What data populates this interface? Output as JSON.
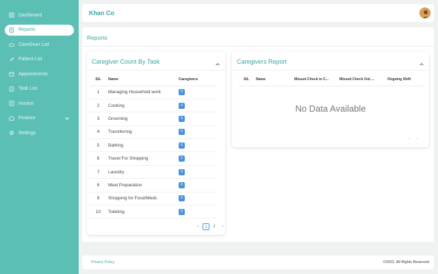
{
  "sidebar": {
    "items": [
      {
        "label": "Dashboard",
        "icon": "dashboard-icon"
      },
      {
        "label": "Reports",
        "icon": "reports-icon",
        "active": true
      },
      {
        "label": "CareGiver List",
        "icon": "caregiver-icon"
      },
      {
        "label": "Patient List",
        "icon": "patient-icon"
      },
      {
        "label": "Appointments",
        "icon": "calendar-icon"
      },
      {
        "label": "Task List",
        "icon": "task-icon"
      },
      {
        "label": "Invoice",
        "icon": "invoice-icon"
      },
      {
        "label": "Finance",
        "icon": "finance-icon"
      },
      {
        "label": "Settings",
        "icon": "gear-icon"
      }
    ]
  },
  "header": {
    "brand": "Khan Co"
  },
  "main": {
    "title": "Reports",
    "task_card": {
      "title": "Caregiver Count By Task",
      "columns": {
        "sl": "S/L",
        "name": "Name",
        "caregivers": "Caregivers"
      },
      "rows": [
        {
          "sl": "1",
          "name": "Managing Household work",
          "count": "0"
        },
        {
          "sl": "2",
          "name": "Cooking",
          "count": "0"
        },
        {
          "sl": "3",
          "name": "Grooming",
          "count": "0"
        },
        {
          "sl": "4",
          "name": "Transferring",
          "count": "0"
        },
        {
          "sl": "5",
          "name": "Bathing",
          "count": "0"
        },
        {
          "sl": "6",
          "name": "Travel For Shopping",
          "count": "0"
        },
        {
          "sl": "7",
          "name": "Laundry",
          "count": "0"
        },
        {
          "sl": "8",
          "name": "Meal Preparation",
          "count": "0"
        },
        {
          "sl": "9",
          "name": "Shopping for Food/Meds",
          "count": "0"
        },
        {
          "sl": "10",
          "name": "Toileting",
          "count": "0"
        }
      ],
      "pagination": {
        "prev": "‹",
        "page1": "1",
        "page2": "2",
        "next": "›"
      }
    },
    "report_card": {
      "title": "Caregivers Report",
      "columns": {
        "sl": "S/L",
        "name": "Name",
        "missed_in": "Missed Check in C...",
        "missed_out": "Missed Check Out ...",
        "ongoing": "Ongoing Shift"
      },
      "empty": "No Data Available",
      "pagination": {
        "prev": "‹",
        "next": "›"
      }
    }
  },
  "footer": {
    "privacy": "Privacy Policy",
    "copyright": "©2022. All Rights Reserved"
  },
  "colors": {
    "sidebar": "#5bbfb5",
    "accent": "#3aa79c",
    "badge": "#4a90e2"
  }
}
